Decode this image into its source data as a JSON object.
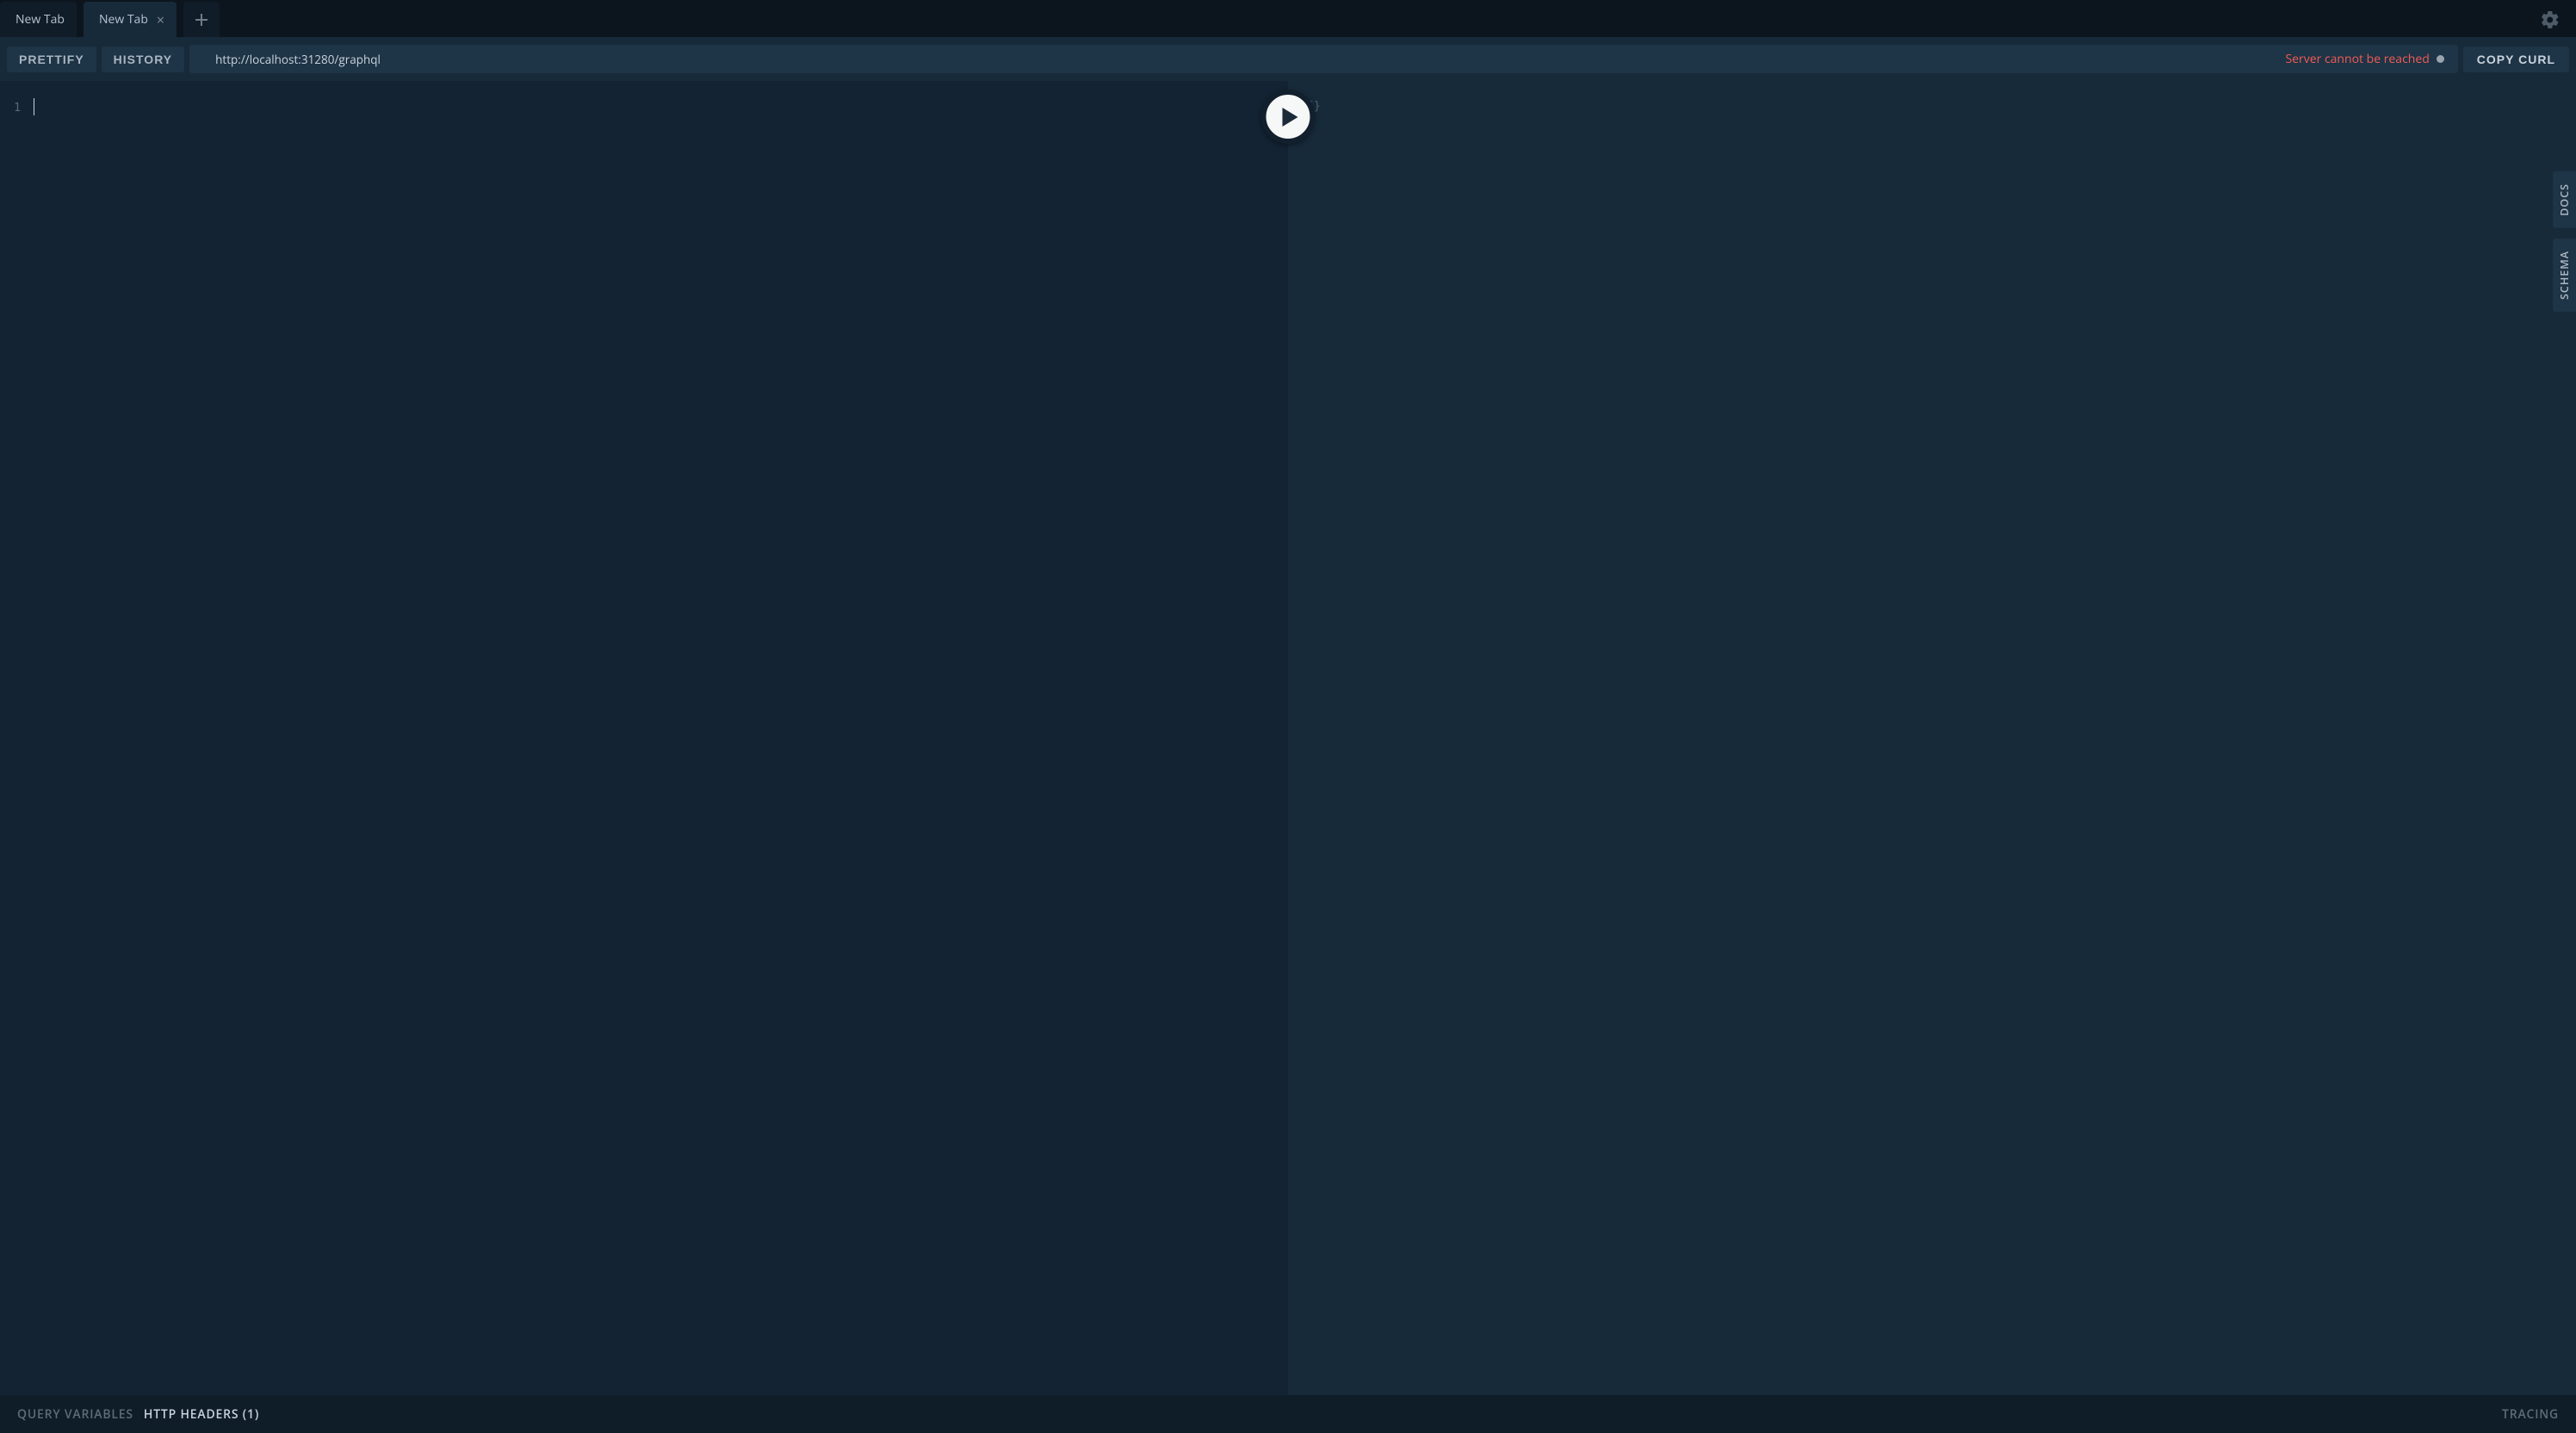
{
  "tabs": [
    {
      "label": "New Tab",
      "active": false
    },
    {
      "label": "New Tab",
      "active": true
    }
  ],
  "toolbar": {
    "prettify": "PRETTIFY",
    "history": "HISTORY",
    "endpoint": "http://localhost:31280/graphql",
    "status": "Server cannot be reached",
    "copy_curl": "COPY CURL"
  },
  "editor": {
    "line_number": "1",
    "result_placeholder": "{}"
  },
  "side": {
    "docs": "DOCS",
    "schema": "SCHEMA"
  },
  "bottom": {
    "query_vars": "QUERY VARIABLES",
    "http_headers": "HTTP HEADERS (1)",
    "tracing": "TRACING"
  }
}
